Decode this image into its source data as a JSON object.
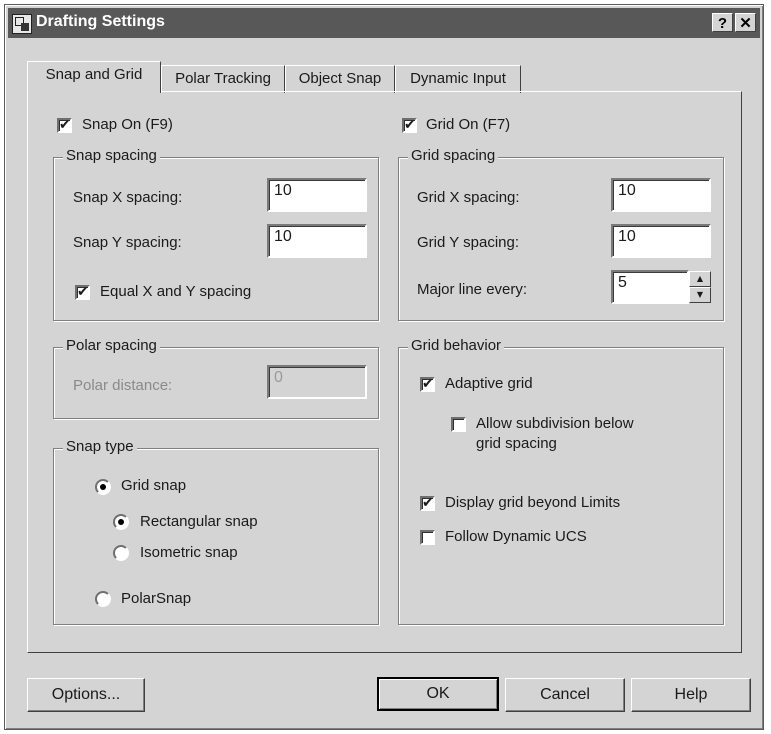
{
  "window": {
    "title": "Drafting Settings",
    "help_btn": "?",
    "close_btn": "✕"
  },
  "tabs": [
    {
      "label": "Snap and Grid"
    },
    {
      "label": "Polar Tracking"
    },
    {
      "label": "Object Snap"
    },
    {
      "label": "Dynamic Input"
    }
  ],
  "snap": {
    "on_label": "Snap On (F9)",
    "on_checked": "✔",
    "spacing_legend": "Snap spacing",
    "x_label": "Snap X spacing:",
    "x_value": "10",
    "y_label": "Snap Y spacing:",
    "y_value": "10",
    "equal_label": "Equal X and Y spacing",
    "equal_checked": "✔"
  },
  "polar": {
    "legend": "Polar spacing",
    "distance_label": "Polar distance:",
    "distance_value": "0"
  },
  "snap_type": {
    "legend": "Snap type",
    "grid_snap": "Grid snap",
    "rectangular": "Rectangular snap",
    "isometric": "Isometric snap",
    "polarsnap": "PolarSnap",
    "selected": [
      "Grid snap",
      "Rectangular snap"
    ]
  },
  "grid": {
    "on_label": "Grid On (F7)",
    "on_checked": "✔",
    "spacing_legend": "Grid spacing",
    "x_label": "Grid X spacing:",
    "x_value": "10",
    "y_label": "Grid Y spacing:",
    "y_value": "10",
    "major_label": "Major line every:",
    "major_value": "5"
  },
  "behavior": {
    "legend": "Grid behavior",
    "adaptive": "Adaptive grid",
    "adaptive_checked": "✔",
    "subdivision_line1": "Allow subdivision below",
    "subdivision_line2": "grid spacing",
    "beyond_limits": "Display grid beyond Limits",
    "beyond_checked": "✔",
    "follow_ucs": "Follow Dynamic UCS"
  },
  "buttons": {
    "options": "Options...",
    "ok": "OK",
    "cancel": "Cancel",
    "help": "Help"
  }
}
